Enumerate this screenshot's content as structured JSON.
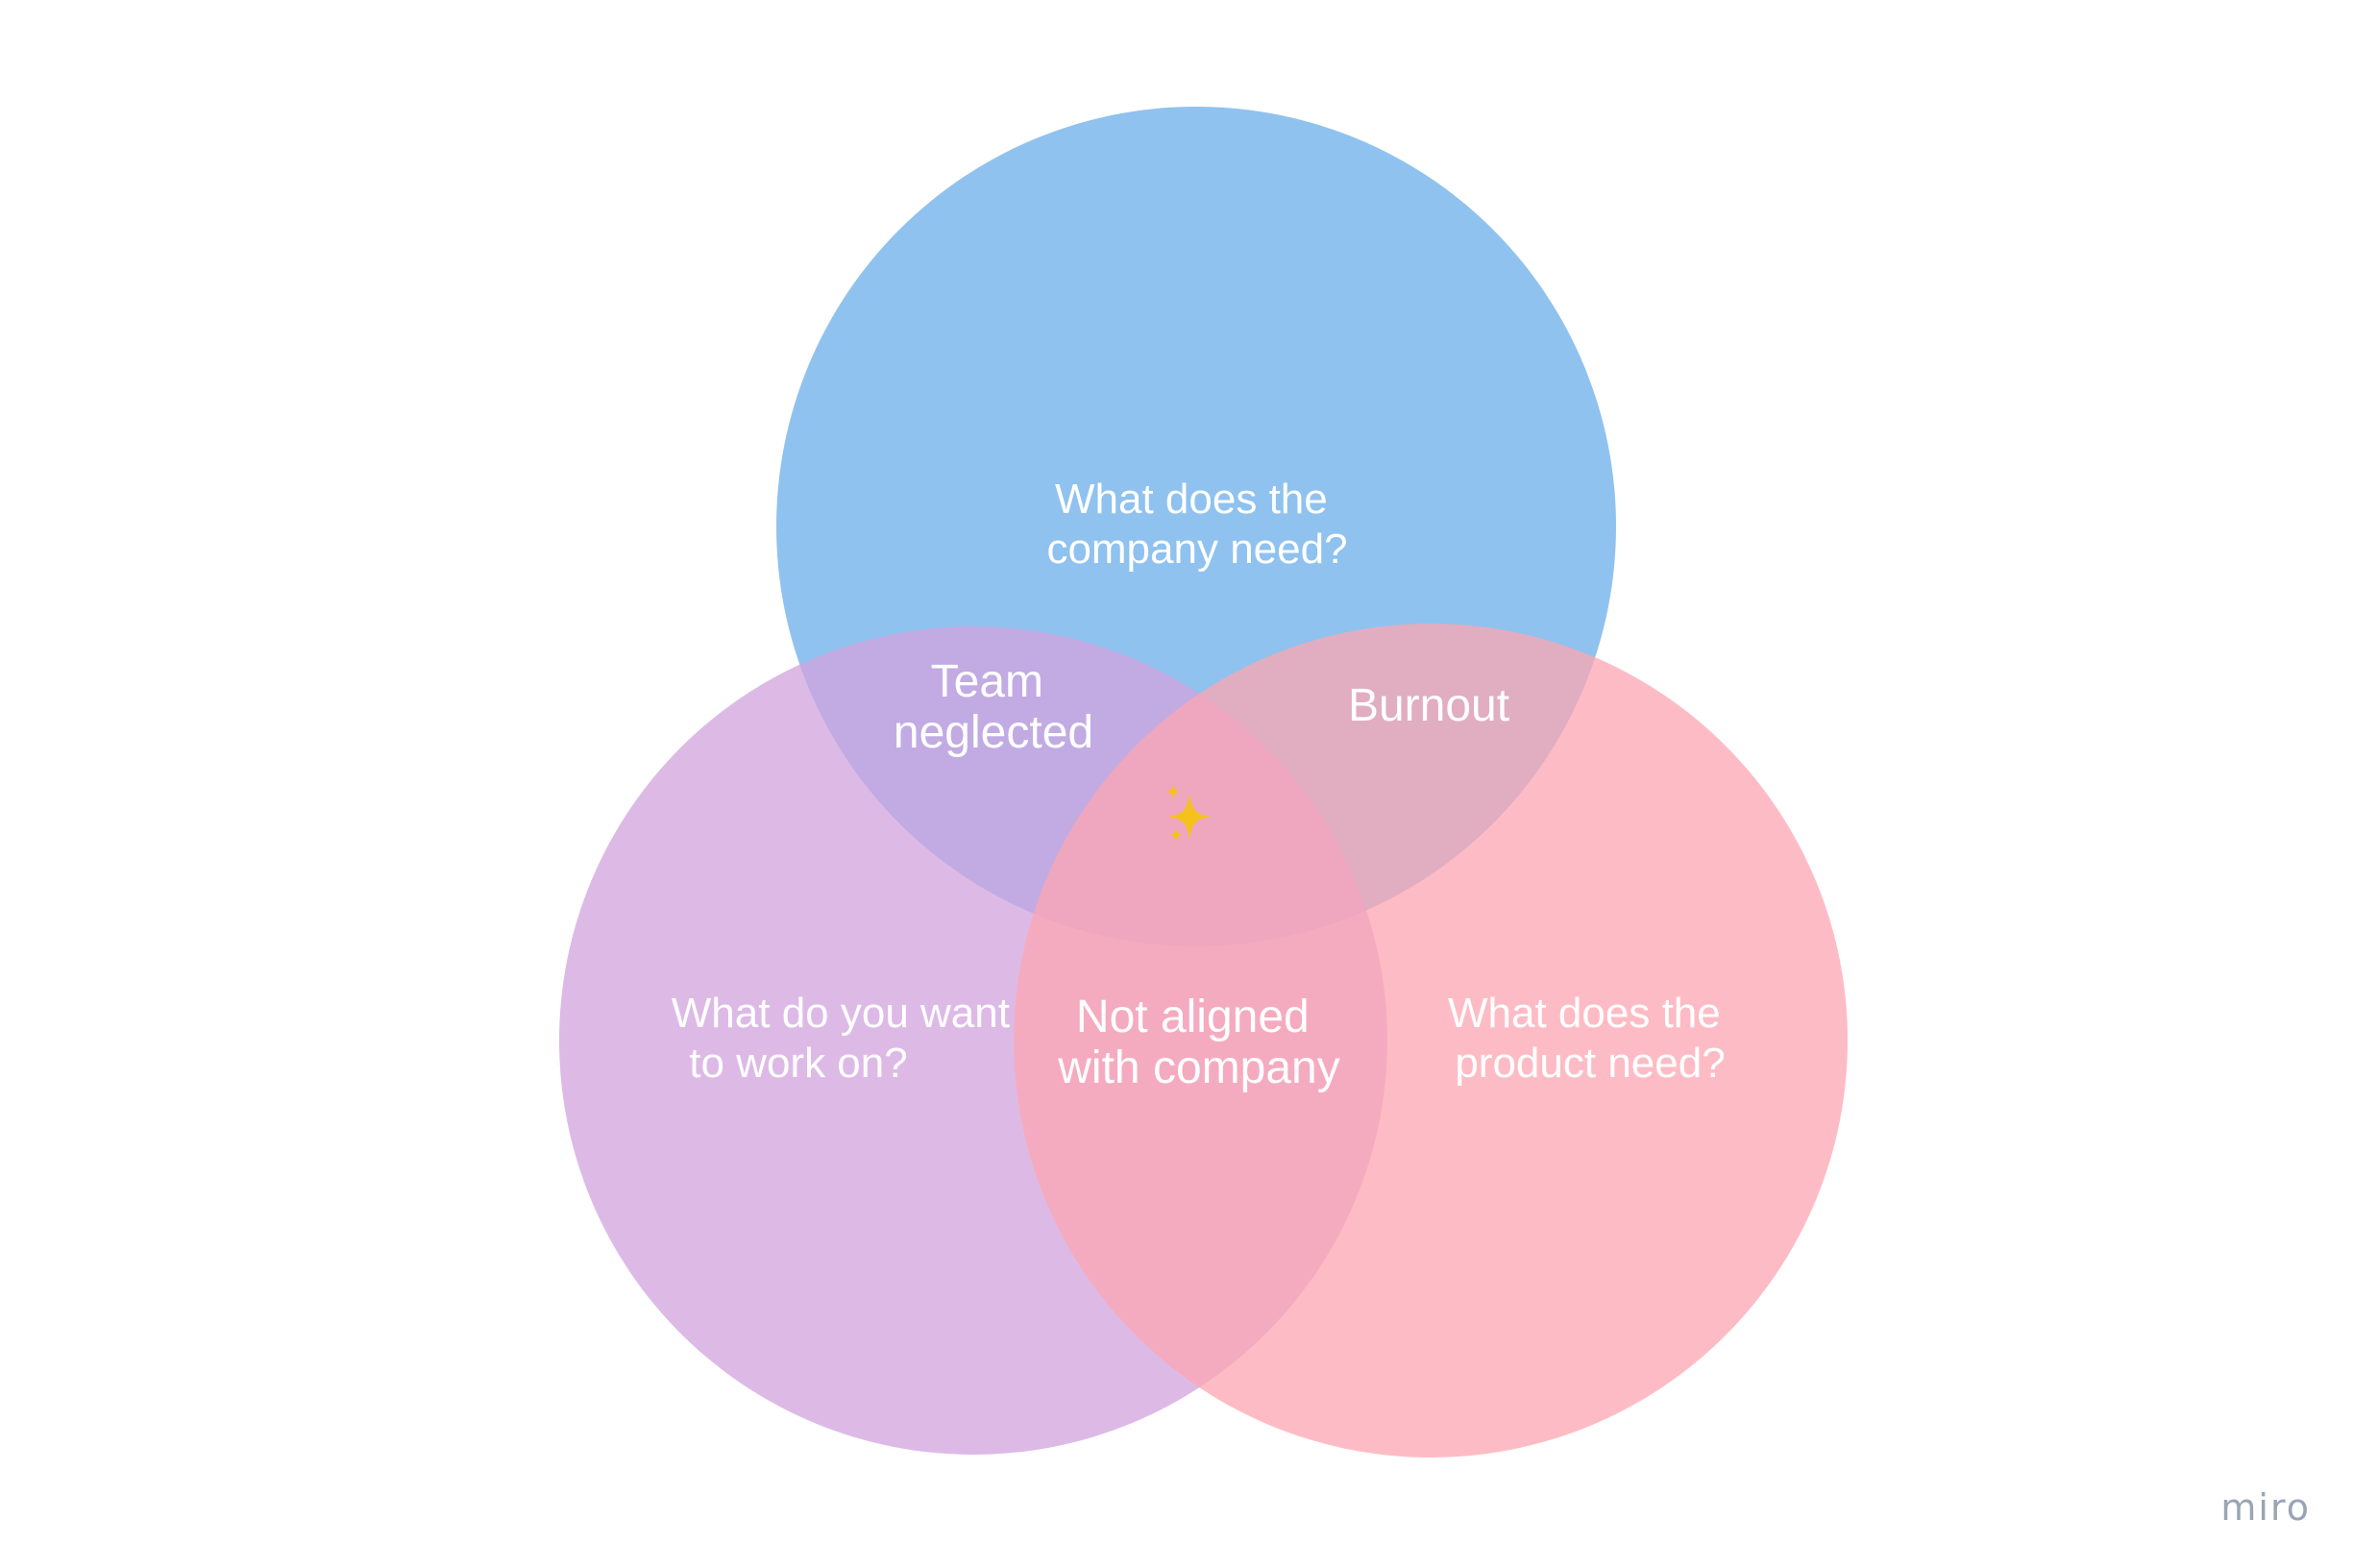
{
  "diagram": {
    "circles": [
      {
        "id": "company",
        "lines": [
          "What does the",
          "company need?"
        ],
        "color": "#6aaeea"
      },
      {
        "id": "you",
        "lines": [
          "What do you want",
          "to work on?"
        ],
        "color": "#d2a3dd"
      },
      {
        "id": "product",
        "lines": [
          "What does the",
          "product need?"
        ],
        "color": "#fca5b2"
      }
    ],
    "overlaps": {
      "company_you": {
        "lines": [
          "Team",
          "neglected"
        ]
      },
      "company_product": {
        "lines": [
          "Burnout"
        ]
      },
      "you_product": {
        "lines": [
          "Not aligned",
          "with company"
        ]
      },
      "center": {
        "icon": "sparkles-icon",
        "glyph": "✨",
        "color": "#f5c21b"
      }
    }
  },
  "watermark": {
    "text": "miro"
  }
}
